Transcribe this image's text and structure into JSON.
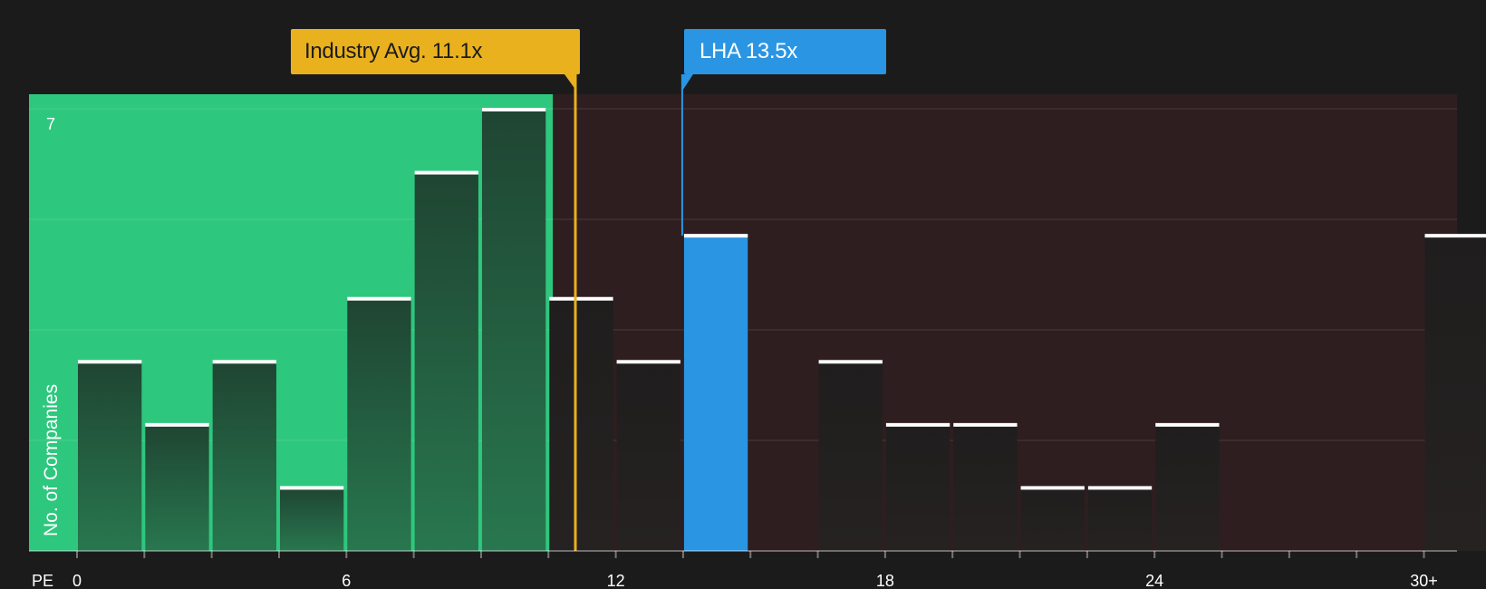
{
  "chart_data": {
    "type": "bar",
    "title": "",
    "xlabel": "PE",
    "ylabel": "No. of Companies",
    "x_ticks": [
      "0",
      "6",
      "12",
      "18",
      "24",
      "30+"
    ],
    "x_tick_values": [
      0,
      6,
      12,
      18,
      24,
      30
    ],
    "y_tick_label": "7",
    "xlim": [
      0,
      30.8
    ],
    "ylim": [
      0,
      7.25
    ],
    "bin_width": 1.5,
    "bins": [
      {
        "start": 0.0,
        "value": 3
      },
      {
        "start": 1.5,
        "value": 2
      },
      {
        "start": 3.0,
        "value": 3
      },
      {
        "start": 4.5,
        "value": 1
      },
      {
        "start": 6.0,
        "value": 4
      },
      {
        "start": 7.5,
        "value": 6
      },
      {
        "start": 9.0,
        "value": 7
      },
      {
        "start": 10.5,
        "value": 4
      },
      {
        "start": 12.0,
        "value": 3
      },
      {
        "start": 13.5,
        "value": 5,
        "highlight": true
      },
      {
        "start": 15.0,
        "value": 0
      },
      {
        "start": 16.5,
        "value": 3
      },
      {
        "start": 18.0,
        "value": 2
      },
      {
        "start": 19.5,
        "value": 2
      },
      {
        "start": 21.0,
        "value": 1
      },
      {
        "start": 22.5,
        "value": 1
      },
      {
        "start": 24.0,
        "value": 2
      },
      {
        "start": 25.5,
        "value": 0
      },
      {
        "start": 27.0,
        "value": 0
      },
      {
        "start": 28.5,
        "value": 0
      },
      {
        "start": 30.0,
        "value": 5
      }
    ],
    "industry_avg": 11.1,
    "company_value": 13.5,
    "undervalued_threshold": 10.6,
    "grid": true
  },
  "callouts": {
    "industry_label": "Industry Avg. 11.1x",
    "company_label": "LHA 13.5x"
  },
  "colors": {
    "background": "#1b1b1b",
    "undervalued_zone": "#2ec77e",
    "overvalued_zone": "#2e1e1f",
    "bar_green": "#24543b",
    "bar_dark": "#232020",
    "company_bar": "#2a95e3",
    "industry_line": "#e9b11e",
    "company_line": "#2a95e3"
  }
}
